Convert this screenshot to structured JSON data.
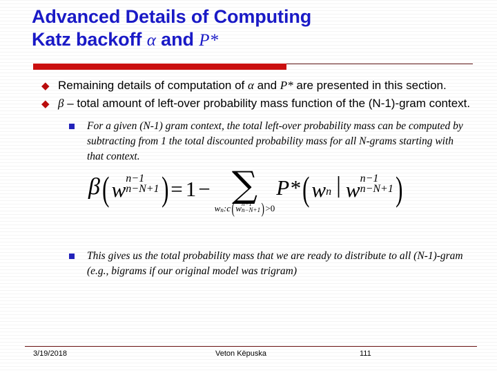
{
  "slide": {
    "title": {
      "line1": "Advanced Details of Computing",
      "line2_pre": "Katz backoff ",
      "line2_alpha": "α",
      "line2_mid": " and ",
      "line2_pstar": "P*"
    },
    "accent_colors": {
      "title_blue": "#1a1ac8",
      "rule_red": "#cc1111",
      "rule_thin": "#5a1010",
      "bullet_red": "#bb0d0d",
      "sub_bullet_blue": "#2222bb"
    },
    "bullets": [
      {
        "marker": "◆",
        "level": 1,
        "text_pre": "Remaining details of computation of ",
        "sym1": "α",
        "text_mid": " and ",
        "sym2": "P*",
        "text_post": " are presented in this section."
      },
      {
        "marker": "◆",
        "level": 1,
        "text_pre": "",
        "sym1": "β",
        "text_mid": " – total amount of left-over probability mass function of the (N-1)-gram context.",
        "sym2": "",
        "text_post": ""
      }
    ],
    "sub_bullets": [
      {
        "marker": "square",
        "level": 2,
        "text": "For a given (N-1) gram context, the total left-over probability mass can be computed by subtracting from 1 the total discounted probability mass for all N-grams starting with that context."
      },
      {
        "marker": "square",
        "level": 2,
        "text": "This gives us the total probability mass that we are ready to distribute to all (N-1)-gram (e.g., bigrams if our original model was trigram)"
      }
    ],
    "equation": {
      "description": "beta(w_{n-N+1}^{n-1}) = 1 - sum over w_n : c(w_{n-N+1}^{n-1}) > 0 of P*(w_n | w_{n-N+1}^{n-1})",
      "lhs_symbol": "β",
      "lhs_open": "(",
      "lhs_var": "w",
      "lhs_sup": "n−1",
      "lhs_sub": "n−N+1",
      "lhs_close": ")",
      "equals": "=",
      "one": "1",
      "minus": "−",
      "sum_sign": "∑",
      "sum_sub_var": "w",
      "sum_sub_var_sub": "n",
      "sum_sub_colon": ":",
      "sum_sub_c": "c",
      "sum_sub_open": "(",
      "sum_sub_w": "w",
      "sum_sub_sup": "n−1",
      "sum_sub_sub": "n−N+1",
      "sum_sub_close": ")",
      "sum_sub_gt": ">",
      "sum_sub_zero": "0",
      "pstar": "P*",
      "rhs_open": "(",
      "rhs_var1": "w",
      "rhs_var1_sub": "n",
      "rhs_mid": "|",
      "rhs_var2": "w",
      "rhs_sup": "n−1",
      "rhs_sub": "n−N+1",
      "rhs_close": ")"
    },
    "footer": {
      "date": "3/19/2018",
      "author": "Veton Këpuska",
      "page": "111"
    }
  }
}
